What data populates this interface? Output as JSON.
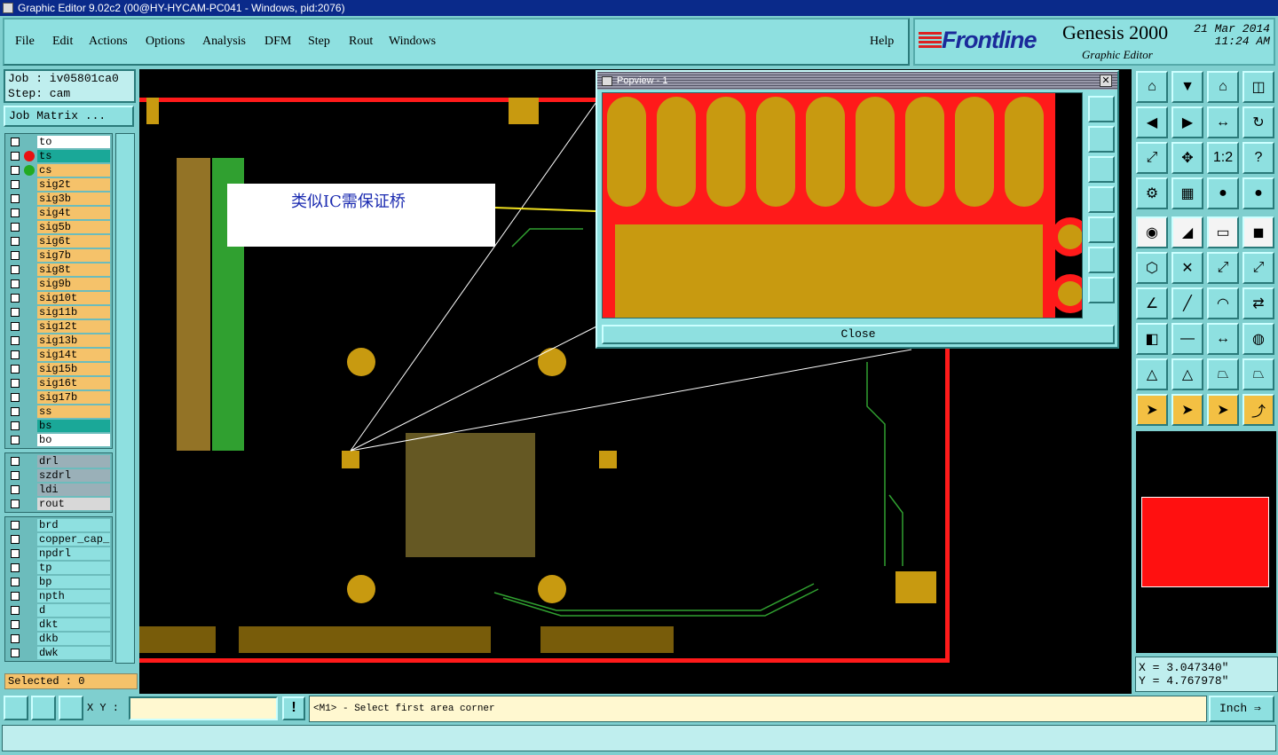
{
  "window": {
    "title": "Graphic Editor 9.02c2 (00@HY-HYCAM-PC041 - Windows, pid:2076)"
  },
  "menu": {
    "items": [
      "File",
      "Edit",
      "Actions",
      "Options",
      "Analysis",
      "DFM",
      "Step",
      "Rout",
      "Windows"
    ],
    "help": "Help"
  },
  "brand": {
    "logo": "Frontline",
    "product": "Genesis 2000",
    "subtitle": "Graphic Editor",
    "date": "21 Mar 2014",
    "time": "11:24 AM"
  },
  "job": {
    "job_line": "Job : iv05801ca0",
    "step_line": "Step: cam",
    "matrix_button": "Job Matrix ..."
  },
  "layers": {
    "signal": [
      {
        "name": "to",
        "color": "#ffffff",
        "dot": ""
      },
      {
        "name": "ts",
        "color": "#1aa898",
        "dot": "#e81010"
      },
      {
        "name": "cs",
        "color": "#f5c26a",
        "dot": "#22aa22"
      },
      {
        "name": "sig2t",
        "color": "#f5c26a",
        "dot": ""
      },
      {
        "name": "sig3b",
        "color": "#f5c26a",
        "dot": ""
      },
      {
        "name": "sig4t",
        "color": "#f5c26a",
        "dot": ""
      },
      {
        "name": "sig5b",
        "color": "#f5c26a",
        "dot": ""
      },
      {
        "name": "sig6t",
        "color": "#f5c26a",
        "dot": ""
      },
      {
        "name": "sig7b",
        "color": "#f5c26a",
        "dot": ""
      },
      {
        "name": "sig8t",
        "color": "#f5c26a",
        "dot": ""
      },
      {
        "name": "sig9b",
        "color": "#f5c26a",
        "dot": ""
      },
      {
        "name": "sig10t",
        "color": "#f5c26a",
        "dot": ""
      },
      {
        "name": "sig11b",
        "color": "#f5c26a",
        "dot": ""
      },
      {
        "name": "sig12t",
        "color": "#f5c26a",
        "dot": ""
      },
      {
        "name": "sig13b",
        "color": "#f5c26a",
        "dot": ""
      },
      {
        "name": "sig14t",
        "color": "#f5c26a",
        "dot": ""
      },
      {
        "name": "sig15b",
        "color": "#f5c26a",
        "dot": ""
      },
      {
        "name": "sig16t",
        "color": "#f5c26a",
        "dot": ""
      },
      {
        "name": "sig17b",
        "color": "#f5c26a",
        "dot": ""
      },
      {
        "name": "ss",
        "color": "#f5c26a",
        "dot": ""
      },
      {
        "name": "bs",
        "color": "#1aa898",
        "dot": ""
      },
      {
        "name": "bo",
        "color": "#ffffff",
        "dot": ""
      }
    ],
    "drill": [
      {
        "name": "drl",
        "color": "#9ab0b8",
        "dot": ""
      },
      {
        "name": "szdrl",
        "color": "#9ab0b8",
        "dot": ""
      },
      {
        "name": "ldi",
        "color": "#9ab0b8",
        "dot": ""
      },
      {
        "name": "rout",
        "color": "#d8d8d8",
        "dot": ""
      }
    ],
    "misc": [
      {
        "name": "brd",
        "color": "#8ee0e0",
        "dot": ""
      },
      {
        "name": "copper_cap_t",
        "color": "#8ee0e0",
        "dot": ""
      },
      {
        "name": "npdrl",
        "color": "#8ee0e0",
        "dot": ""
      },
      {
        "name": "tp",
        "color": "#8ee0e0",
        "dot": ""
      },
      {
        "name": "bp",
        "color": "#8ee0e0",
        "dot": ""
      },
      {
        "name": "npth",
        "color": "#8ee0e0",
        "dot": ""
      },
      {
        "name": "d",
        "color": "#8ee0e0",
        "dot": ""
      },
      {
        "name": "dkt",
        "color": "#8ee0e0",
        "dot": ""
      },
      {
        "name": "dkb",
        "color": "#8ee0e0",
        "dot": ""
      },
      {
        "name": "dwk",
        "color": "#8ee0e0",
        "dot": ""
      }
    ]
  },
  "selected": "Selected : 0",
  "callout": {
    "text": "类似IC需保证桥"
  },
  "popview": {
    "title": "Popview - 1",
    "close_label": "Close"
  },
  "coords": {
    "x": "X = 3.047340\"",
    "y": "Y = 4.767978\""
  },
  "bottom": {
    "xy_label": "X Y :",
    "xy_value": "",
    "message": "<M1> - Select first area corner",
    "units": "Inch"
  },
  "colors": {
    "copper": "#c89a10",
    "mask": "#ff1a1a",
    "trace": "#30a030",
    "background": "#000000",
    "panel": "#7fcfcf"
  }
}
